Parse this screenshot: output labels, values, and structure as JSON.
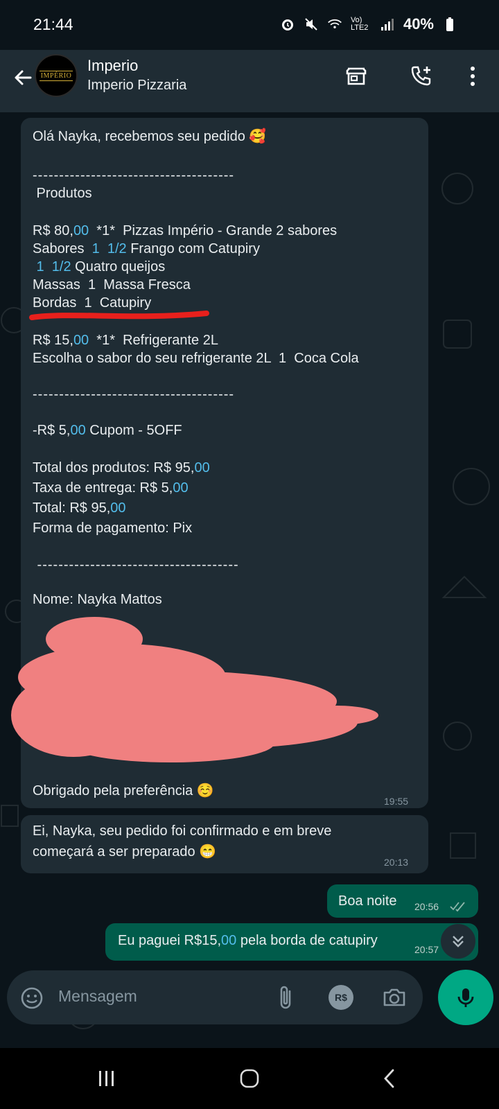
{
  "status": {
    "time": "21:44",
    "network": "Vo) LTE2",
    "battery": "40%"
  },
  "header": {
    "contact_name": "Imperio",
    "contact_subtitle": "Imperio Pizzaria",
    "avatar_text": "IMPÉRIO"
  },
  "messages": {
    "order": {
      "greeting": "Olá Nayka, recebemos seu pedido 🥰",
      "divider1": "--------------------------------------",
      "products_heading": " Produtos",
      "item1_price_a": "R$ 80,",
      "item1_price_b": "00",
      "item1_desc": "  *1*  Pizzas Império - Grande 2 sabores",
      "flavors_a": "Sabores  ",
      "flavors_b": "1  1/2",
      "flavors_c": " Frango com Catupiry",
      "flavor2_a": " 1  1/2",
      "flavor2_b": " Quatro queijos",
      "dough": "Massas  1  Massa Fresca",
      "crust": "Bordas  1  Catupiry",
      "item2_price_a": "R$ 15,",
      "item2_price_b": "00",
      "item2_desc": "  *1*  Refrigerante 2L",
      "soda_choice": "Escolha o sabor do seu refrigerante 2L  1  Coca Cola",
      "divider2": "--------------------------------------",
      "coupon_a": "-R$ 5,",
      "coupon_b": "00",
      "coupon_c": " Cupom - 5OFF",
      "total_products_a": "Total dos produtos: R$ 95,",
      "total_products_b": "00",
      "delivery_a": "Taxa de entrega: R$ 5,",
      "delivery_b": "00",
      "total_a": "Total: R$ 95,",
      "total_b": "00",
      "payment": "Forma de pagamento: Pix",
      "divider3": " --------------------------------------",
      "name": "Nome: Nayka Mattos",
      "thanks": "Obrigado pela preferência ☺️",
      "time": "19:55"
    },
    "confirm": {
      "line1": "Ei, Nayka, seu pedido foi confirmado e em breve",
      "line2": "começará a ser preparado 😁",
      "time": "20:13"
    },
    "out1": {
      "text": "Boa noite",
      "time": "20:56"
    },
    "out2": {
      "text_a": "Eu paguei R$15,",
      "text_b": "00",
      "text_c": " pela borda de catupiry",
      "time": "20:57"
    }
  },
  "composer": {
    "placeholder": "Mensagem",
    "currency_label": "R$"
  },
  "colors": {
    "bubble_in": "#1f2c34",
    "bubble_out": "#005c4b",
    "accent": "#00a884",
    "link_blue": "#53bdeb",
    "annotation_red": "#e8201c",
    "redaction_pink": "#f08080"
  }
}
